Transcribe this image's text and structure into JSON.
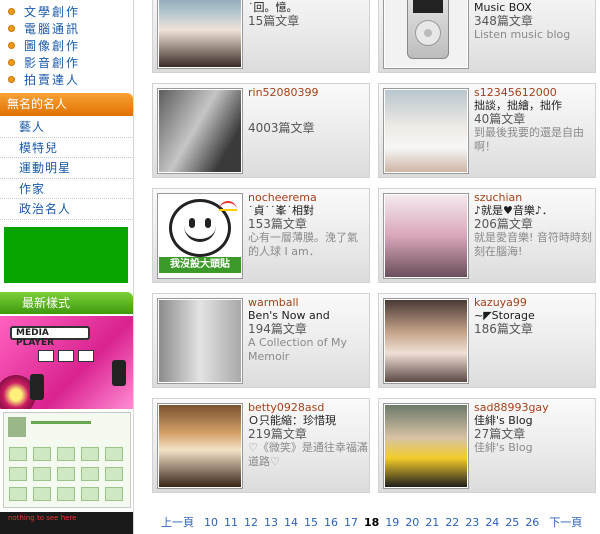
{
  "sidebar": {
    "categories": [
      "文學創作",
      "電腦通訊",
      "圖像創作",
      "影音創作",
      "拍賣達人"
    ],
    "celebrity_title": "無名的名人",
    "celebrity_items": [
      "藝人",
      "模特兒",
      "運動明星",
      "作家",
      "政治名人"
    ],
    "styles_title": "最新樣式",
    "theme1_label": "MEDIA PLAYER",
    "theme3_label": "nothing to see here"
  },
  "blogs": [
    {
      "user": "",
      "title": "˙回。憶。",
      "count": "15篇文章",
      "desc": ""
    },
    {
      "user": "",
      "title": "Music BOX",
      "count": "348篇文章",
      "desc": "Listen music blog"
    },
    {
      "user": "rin52080399",
      "title": "",
      "count": "4003篇文章",
      "desc": ""
    },
    {
      "user": "s12345612000",
      "title": "拙談，拙繪，拙作",
      "count": "40篇文章",
      "desc": "到最後我要的還是自由啊！"
    },
    {
      "user": "nocheerema",
      "title": "˙貞˙˙峯˙相對",
      "count": "153篇文章",
      "desc": "心有一層薄膜。浼了氣的人球 I am．"
    },
    {
      "user": "szuchian",
      "title": "♪就是♥音樂♪．",
      "count": "206篇文章",
      "desc": "就是愛音樂! 音符時時刻刻在腦海!"
    },
    {
      "user": "warmball",
      "title": "Ben's Now and",
      "count": "194篇文章",
      "desc": "A Collection of My Memoir"
    },
    {
      "user": "kazuya99",
      "title": "~◤Storage",
      "count": "186篇文章",
      "desc": ""
    },
    {
      "user": "betty0928asd",
      "title": "Ｏ只能縮：珍惜現",
      "count": "219篇文章",
      "desc": "♡《微笑》是通往幸福滿道路♡"
    },
    {
      "user": "sad88993gay",
      "title": "佳緋's Blog",
      "count": "27篇文章",
      "desc": "佳緋's Blog"
    }
  ],
  "smile_banner": "我沒設大頭貼",
  "pagination": {
    "prev": "上一頁",
    "next": "下一頁",
    "pages": [
      "10",
      "11",
      "12",
      "13",
      "14",
      "15",
      "16",
      "17",
      "18",
      "19",
      "20",
      "21",
      "22",
      "23",
      "24",
      "25",
      "26"
    ],
    "current": "18"
  }
}
